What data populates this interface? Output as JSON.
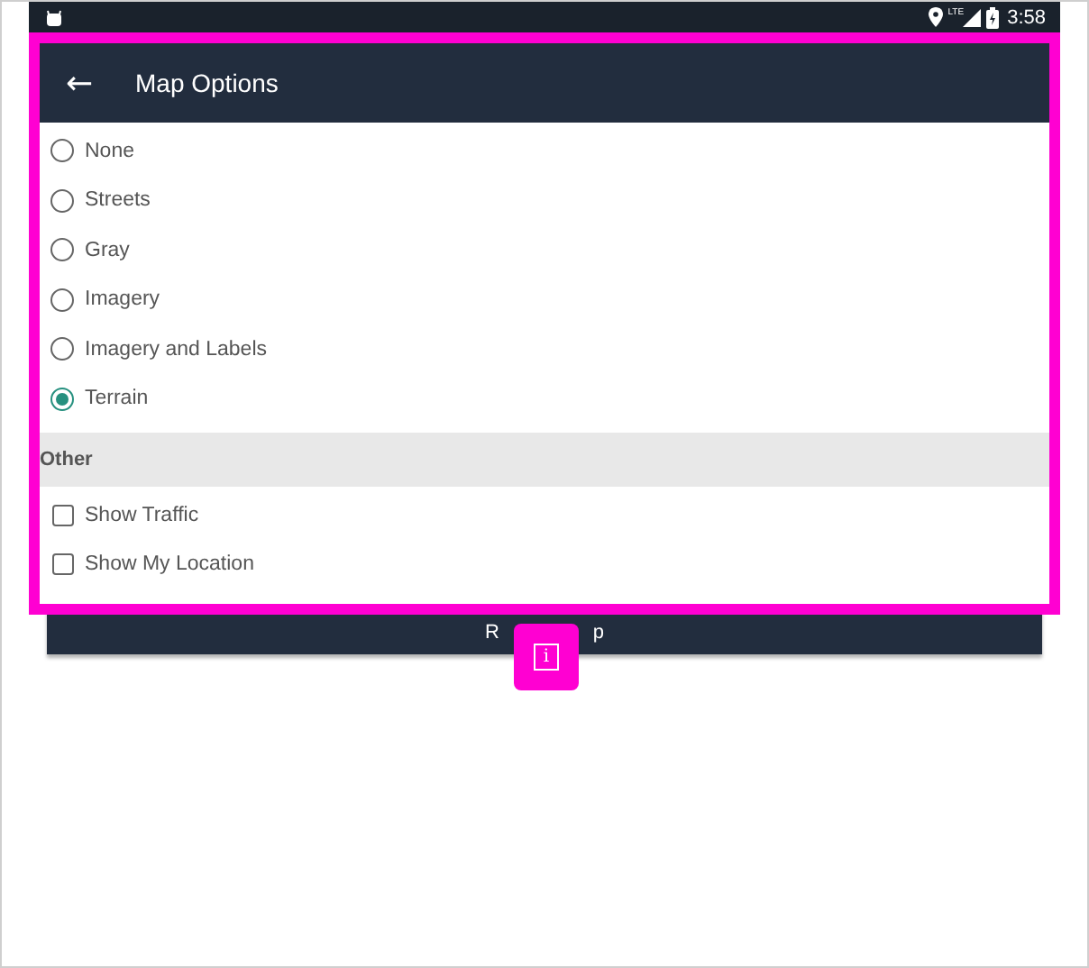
{
  "status_bar": {
    "network": "LTE",
    "time": "3:58"
  },
  "app_bar": {
    "back": "←",
    "title": "Map Options"
  },
  "basemaps": [
    {
      "label": "None",
      "selected": false
    },
    {
      "label": "Streets",
      "selected": false
    },
    {
      "label": "Gray",
      "selected": false
    },
    {
      "label": "Imagery",
      "selected": false
    },
    {
      "label": "Imagery and Labels",
      "selected": false
    },
    {
      "label": "Terrain",
      "selected": true
    }
  ],
  "section": {
    "title": "Other"
  },
  "options": [
    {
      "label": "Show Traffic",
      "checked": false
    },
    {
      "label": "Show My Location",
      "checked": false
    }
  ],
  "button": {
    "label_start": "R",
    "label_end": "p"
  },
  "inspector": {
    "badge": "i"
  }
}
